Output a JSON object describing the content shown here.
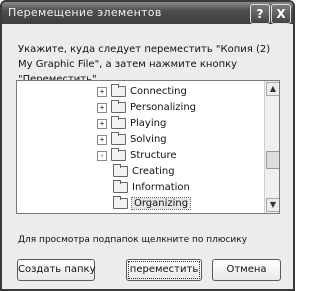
{
  "window": {
    "title": "Перемещение элементов",
    "help_label": "?",
    "close_label": "X"
  },
  "instruction": "Укажите, куда следует переместить \"Копия (2) My Graphic File\", а затем нажмите кнопку \"Переместить\".",
  "tree": {
    "items": [
      {
        "label": "Connecting",
        "expander": "+"
      },
      {
        "label": "Personalizing",
        "expander": "+"
      },
      {
        "label": "Playing",
        "expander": "+"
      },
      {
        "label": "Solving",
        "expander": "+"
      },
      {
        "label": "Structure",
        "expander": "-"
      },
      {
        "label": "Creating",
        "expander": ""
      },
      {
        "label": "Information",
        "expander": ""
      },
      {
        "label": "Organizing",
        "expander": "",
        "selected": true
      }
    ]
  },
  "hint": "Для просмотра подпапок щелкните по плюсику",
  "buttons": {
    "new_folder": "Создать папку",
    "move": "переместить",
    "cancel": "Отмена"
  }
}
